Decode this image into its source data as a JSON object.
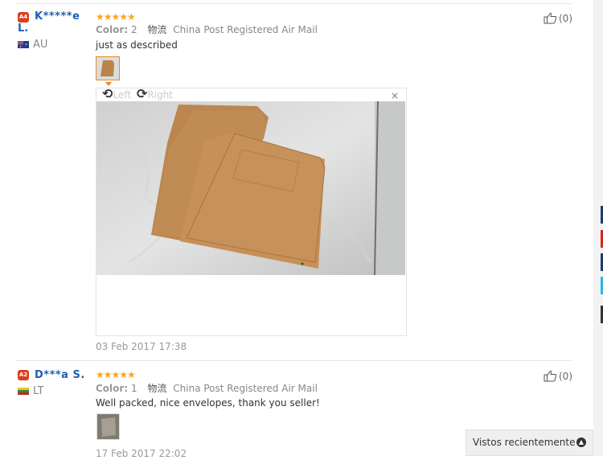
{
  "reviews": [
    {
      "level_badge": "A4",
      "user_name_line1": "K*****e",
      "user_name_line2": "L.",
      "country": "AU",
      "stars": "★★★★★",
      "color_label": "Color:",
      "color_value": "2",
      "logistics_cn": "物流",
      "shipping": "China Post Registered Air Mail",
      "text": "just as described",
      "likes": "(0)",
      "date": "03 Feb 2017 17:38"
    },
    {
      "level_badge": "A2",
      "user_name": "D***a S.",
      "country": "LT",
      "stars": "★★★★★",
      "color_label": "Color:",
      "color_value": "1",
      "logistics_cn": "物流",
      "shipping": "China Post Registered Air Mail",
      "text": "Well packed, nice envelopes, thank you seller!",
      "likes": "(0)",
      "date": "17 Feb 2017 22:02"
    }
  ],
  "viewer": {
    "rotate_left": "Left",
    "rotate_right": "Right",
    "close": "×"
  },
  "recently_viewed": {
    "label": "Vistos recientemente",
    "icon": "chevron-up-icon"
  },
  "colors": {
    "username": "#1e60b4",
    "stars": "#f5a623",
    "badge": "#d9411e",
    "thumb_border": "#e38b2e"
  }
}
